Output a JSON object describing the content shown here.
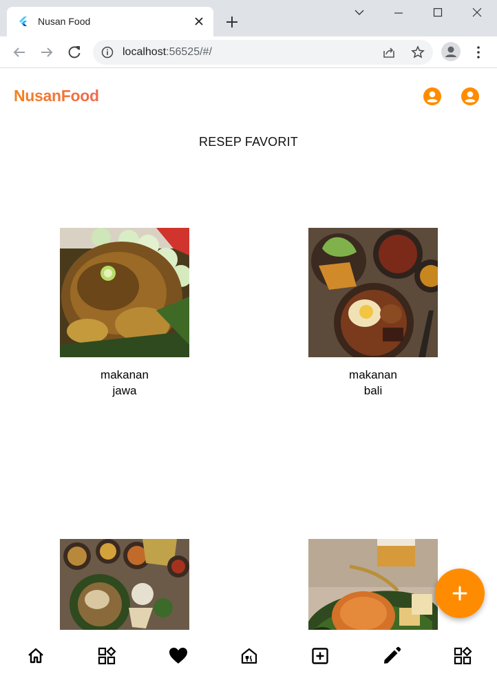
{
  "browser": {
    "tab_title": "Nusan Food",
    "url_host": "localhost",
    "url_rest": ":56525/#/"
  },
  "app": {
    "brand": "NusanFood",
    "page_title": "RESEP FAVORIT",
    "accent_color": "#ff8c00",
    "cards": [
      {
        "line1": "makanan",
        "line2": "jawa",
        "image": "roasted-chicken-photo"
      },
      {
        "line1": "makanan",
        "line2": "bali",
        "image": "egg-curry-bowl-photo"
      },
      {
        "line1": "",
        "line2": "",
        "image": "indonesian-feast-photo"
      },
      {
        "line1": "",
        "line2": "",
        "image": "rice-on-banana-leaf-photo"
      }
    ],
    "bottom_nav": [
      "home-icon",
      "category-icon",
      "heart-icon",
      "house-icon",
      "add-box-icon",
      "pencil-icon",
      "category-icon"
    ]
  }
}
